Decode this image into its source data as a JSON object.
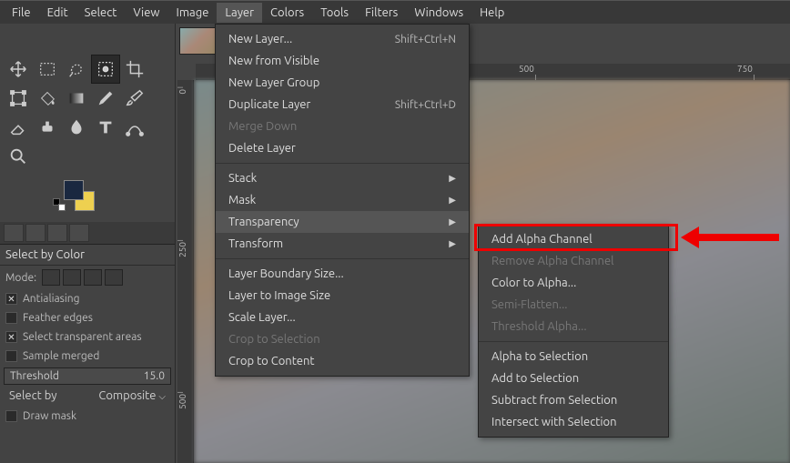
{
  "menubar": [
    "File",
    "Edit",
    "Select",
    "View",
    "Image",
    "Layer",
    "Colors",
    "Tools",
    "Filters",
    "Windows",
    "Help"
  ],
  "active_menu_index": 5,
  "tool_options": {
    "title": "Select by Color",
    "mode_label": "Mode:",
    "antialias": "Antialiasing",
    "feather": "Feather edges",
    "transp": "Select transparent areas",
    "sample": "Sample merged",
    "threshold_label": "Threshold",
    "threshold_value": "15.0",
    "selectby_label": "Select by",
    "selectby_value": "Composite",
    "drawmask": "Draw mask"
  },
  "ruler_h": [
    "500",
    "750"
  ],
  "ruler_v": [
    "0",
    "250",
    "500"
  ],
  "layer_menu": [
    {
      "label": "New Layer...",
      "accel": "Shift+Ctrl+N"
    },
    {
      "label": "New from Visible"
    },
    {
      "label": "New Layer Group"
    },
    {
      "label": "Duplicate Layer",
      "accel": "Shift+Ctrl+D"
    },
    {
      "label": "Merge Down",
      "disabled": true
    },
    {
      "label": "Delete Layer"
    },
    {
      "sep": true
    },
    {
      "label": "Stack",
      "sub": true
    },
    {
      "label": "Mask",
      "sub": true
    },
    {
      "label": "Transparency",
      "sub": true,
      "hover": true
    },
    {
      "label": "Transform",
      "sub": true
    },
    {
      "sep": true
    },
    {
      "label": "Layer Boundary Size..."
    },
    {
      "label": "Layer to Image Size"
    },
    {
      "label": "Scale Layer..."
    },
    {
      "label": "Crop to Selection",
      "disabled": true
    },
    {
      "label": "Crop to Content"
    }
  ],
  "transparency_menu": [
    {
      "label": "Add Alpha Channel",
      "highlight": true
    },
    {
      "label": "Remove Alpha Channel",
      "disabled": true
    },
    {
      "label": "Color to Alpha..."
    },
    {
      "label": "Semi-Flatten...",
      "disabled": true
    },
    {
      "label": "Threshold Alpha...",
      "disabled": true
    },
    {
      "sep": true
    },
    {
      "label": "Alpha to Selection"
    },
    {
      "label": "Add to Selection"
    },
    {
      "label": "Subtract from Selection"
    },
    {
      "label": "Intersect with Selection"
    }
  ]
}
